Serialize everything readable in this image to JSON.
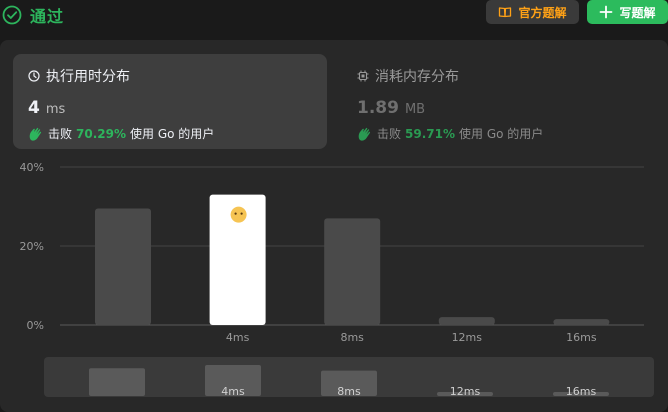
{
  "header": {
    "status": "通过",
    "official_solution": "官方题解",
    "write_solution": "写题解"
  },
  "runtime_card": {
    "title": "执行用时分布",
    "value": "4",
    "unit": "ms",
    "beat_label": "击败",
    "beat_pct": "70.29%",
    "beat_suffix": "使用 Go 的用户"
  },
  "memory_card": {
    "title": "消耗内存分布",
    "value": "1.89",
    "unit": "MB",
    "beat_label": "击败",
    "beat_pct": "59.71%",
    "beat_suffix": "使用 Go 的用户"
  },
  "colors": {
    "accent_green": "#2db55d",
    "accent_orange": "#ffa116",
    "bar": "#4a4a4a",
    "bar_highlight": "#ffffff"
  },
  "chart_data": {
    "type": "bar",
    "categories": [
      "",
      "4ms",
      "8ms",
      "12ms",
      "16ms"
    ],
    "values": [
      29.5,
      33,
      27,
      2,
      1.5
    ],
    "highlight_index": 1,
    "y_ticks": [
      "0%",
      "20%",
      "40%"
    ],
    "ylim": [
      0,
      40
    ],
    "grid": true,
    "overview_labels": [
      "",
      "4ms",
      "8ms",
      "12ms",
      "16ms"
    ]
  }
}
